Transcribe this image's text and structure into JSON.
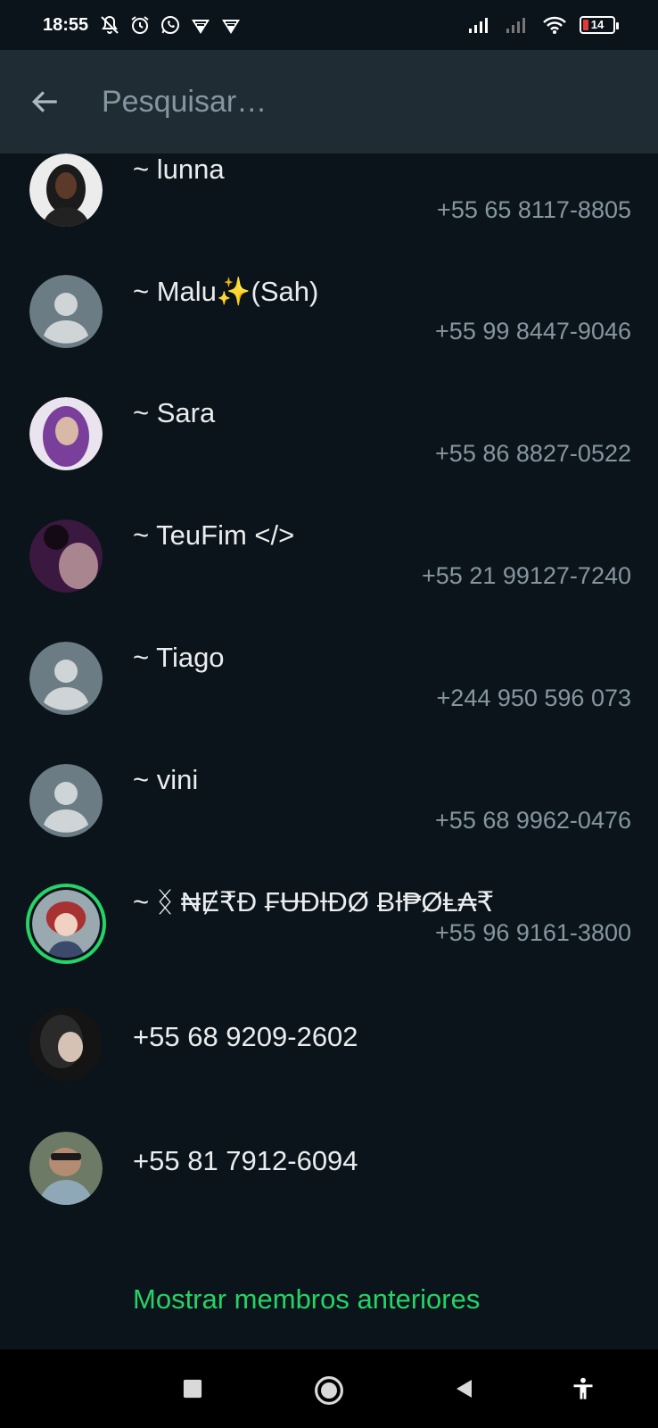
{
  "status_bar": {
    "time": "18:55",
    "battery_level": "14",
    "icons_left": [
      "mute-icon",
      "alarm-icon",
      "whatsapp-icon",
      "vpn-icon",
      "vpn-icon"
    ],
    "icons_right": [
      "signal-icon",
      "signal-off-icon",
      "wifi-icon",
      "battery-icon"
    ]
  },
  "header": {
    "search_placeholder": "Pesquisar…"
  },
  "contacts": [
    {
      "name": "~ lunna",
      "phone": "+55 65 8117-8805",
      "avatar": "photo",
      "avatar_color": "#e8e8e8"
    },
    {
      "name": "~ Malu✨(Sah)",
      "phone": "+55 99 8447-9046",
      "avatar": "default",
      "avatar_color": "#6b7c85"
    },
    {
      "name": "~ Sara",
      "phone": "+55 86 8827-0522",
      "avatar": "photo",
      "avatar_color": "#b08fc9"
    },
    {
      "name": "~ TeuFim </>",
      "phone": "+55 21 99127-7240",
      "avatar": "photo",
      "avatar_color": "#4a2150"
    },
    {
      "name": "~ Tiago",
      "phone": "+244 950 596 073",
      "avatar": "default",
      "avatar_color": "#6b7c85"
    },
    {
      "name": "~ vini",
      "phone": "+55 68 9962-0476",
      "avatar": "default",
      "avatar_color": "#6b7c85"
    },
    {
      "name": "~ ᛝ ₦Ɇ₹Đ ₣ɄĐƗĐØ ɃƗ₱ØⱠ₳₹",
      "phone": "+55 96 9161-3800",
      "avatar": "photo",
      "avatar_color": "#8a3a3a",
      "status_ring": "#25d366"
    },
    {
      "name": "+55 68 9209-2602",
      "phone": "",
      "avatar": "photo",
      "avatar_color": "#2e2e2e"
    },
    {
      "name": "+55 81 7912-6094",
      "phone": "",
      "avatar": "photo",
      "avatar_color": "#5a6a58"
    }
  ],
  "show_more_label": "Mostrar membros anteriores",
  "nav": {
    "icons": [
      "recents-icon",
      "home-icon",
      "back-icon",
      "accessibility-icon"
    ]
  },
  "colors": {
    "background": "#0b141a",
    "header": "#1f2c34",
    "accent": "#25d366",
    "secondary_text": "#8696a0"
  }
}
